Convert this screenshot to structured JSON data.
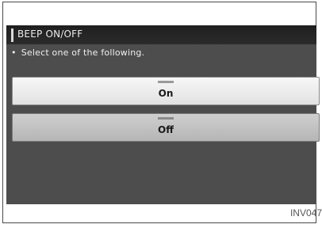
{
  "header": {
    "title": "BEEP ON/OFF"
  },
  "instruction": {
    "bullet": "•",
    "text": "Select one of the following."
  },
  "options": [
    {
      "label": "On",
      "selected": false
    },
    {
      "label": "Off",
      "selected": true
    }
  ],
  "figure_code": "INV047",
  "colors": {
    "screen_bg": "#4d4d4d",
    "titlebar_bg": "#222222",
    "option_on_bg": "#f0f0f0",
    "option_off_bg": "#c2c2c2"
  }
}
